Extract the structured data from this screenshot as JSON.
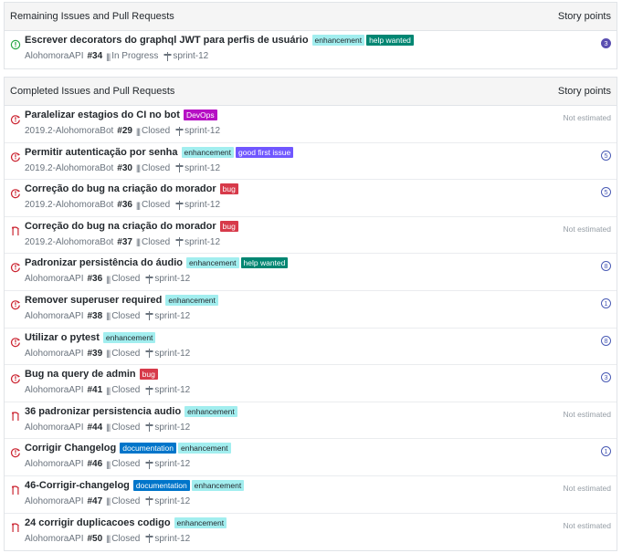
{
  "remaining": {
    "title": "Remaining Issues and Pull Requests",
    "sp_header": "Story points",
    "items": [
      {
        "state": "open",
        "title": "Escrever decorators do graphql JWT para perfis de usuário",
        "labels": [
          {
            "text": "enhancement",
            "bg": "#a2eeef",
            "fg": "#24292e"
          },
          {
            "text": "help wanted",
            "bg": "#008672",
            "fg": "#ffffff"
          }
        ],
        "repo": "AlohomoraAPI",
        "number": "#34",
        "status": "In Progress",
        "milestone": "sprint-12",
        "points": "3",
        "points_style": "filled"
      }
    ]
  },
  "completed": {
    "title": "Completed Issues and Pull Requests",
    "sp_header": "Story points",
    "items": [
      {
        "state": "closed-issue",
        "title": "Paralelizar estagios do CI no bot",
        "labels": [
          {
            "text": "DevOps",
            "bg": "#b60fc4",
            "fg": "#ffffff"
          }
        ],
        "repo": "2019.2-AlohomoraBot",
        "number": "#29",
        "status": "Closed",
        "milestone": "sprint-12",
        "points": "Not estimated",
        "points_style": "text"
      },
      {
        "state": "closed-issue",
        "title": "Permitir autenticação por senha",
        "labels": [
          {
            "text": "enhancement",
            "bg": "#a2eeef",
            "fg": "#24292e"
          },
          {
            "text": "good first issue",
            "bg": "#7057ff",
            "fg": "#ffffff"
          }
        ],
        "repo": "2019.2-AlohomoraBot",
        "number": "#30",
        "status": "Closed",
        "milestone": "sprint-12",
        "points": "5",
        "points_style": "circle"
      },
      {
        "state": "closed-issue",
        "title": "Correção do bug na criação do morador",
        "labels": [
          {
            "text": "bug",
            "bg": "#d73a4a",
            "fg": "#ffffff"
          }
        ],
        "repo": "2019.2-AlohomoraBot",
        "number": "#36",
        "status": "Closed",
        "milestone": "sprint-12",
        "points": "5",
        "points_style": "circle"
      },
      {
        "state": "merged-pr",
        "title": "Correção do bug na criação do morador",
        "labels": [
          {
            "text": "bug",
            "bg": "#d73a4a",
            "fg": "#ffffff"
          }
        ],
        "repo": "2019.2-AlohomoraBot",
        "number": "#37",
        "status": "Closed",
        "milestone": "sprint-12",
        "points": "Not estimated",
        "points_style": "text"
      },
      {
        "state": "closed-issue",
        "title": "Padronizar persistência do áudio",
        "labels": [
          {
            "text": "enhancement",
            "bg": "#a2eeef",
            "fg": "#24292e"
          },
          {
            "text": "help wanted",
            "bg": "#008672",
            "fg": "#ffffff"
          }
        ],
        "repo": "AlohomoraAPI",
        "number": "#36",
        "status": "Closed",
        "milestone": "sprint-12",
        "points": "8",
        "points_style": "circle"
      },
      {
        "state": "closed-issue",
        "title": "Remover superuser required",
        "labels": [
          {
            "text": "enhancement",
            "bg": "#a2eeef",
            "fg": "#24292e"
          }
        ],
        "repo": "AlohomoraAPI",
        "number": "#38",
        "status": "Closed",
        "milestone": "sprint-12",
        "points": "1",
        "points_style": "circle"
      },
      {
        "state": "closed-issue",
        "title": "Utilizar o pytest",
        "labels": [
          {
            "text": "enhancement",
            "bg": "#a2eeef",
            "fg": "#24292e"
          }
        ],
        "repo": "AlohomoraAPI",
        "number": "#39",
        "status": "Closed",
        "milestone": "sprint-12",
        "points": "8",
        "points_style": "circle"
      },
      {
        "state": "closed-issue",
        "title": "Bug na query de admin",
        "labels": [
          {
            "text": "bug",
            "bg": "#d73a4a",
            "fg": "#ffffff"
          }
        ],
        "repo": "AlohomoraAPI",
        "number": "#41",
        "status": "Closed",
        "milestone": "sprint-12",
        "points": "3",
        "points_style": "circle"
      },
      {
        "state": "merged-pr",
        "title": "36 padronizar persistencia audio",
        "labels": [
          {
            "text": "enhancement",
            "bg": "#a2eeef",
            "fg": "#24292e"
          }
        ],
        "repo": "AlohomoraAPI",
        "number": "#44",
        "status": "Closed",
        "milestone": "sprint-12",
        "points": "Not estimated",
        "points_style": "text"
      },
      {
        "state": "closed-issue",
        "title": "Corrigir Changelog",
        "labels": [
          {
            "text": "documentation",
            "bg": "#0075ca",
            "fg": "#ffffff"
          },
          {
            "text": "enhancement",
            "bg": "#a2eeef",
            "fg": "#24292e"
          }
        ],
        "repo": "AlohomoraAPI",
        "number": "#46",
        "status": "Closed",
        "milestone": "sprint-12",
        "points": "1",
        "points_style": "circle"
      },
      {
        "state": "merged-pr",
        "title": "46-Corrigir-changelog",
        "labels": [
          {
            "text": "documentation",
            "bg": "#0075ca",
            "fg": "#ffffff"
          },
          {
            "text": "enhancement",
            "bg": "#a2eeef",
            "fg": "#24292e"
          }
        ],
        "repo": "AlohomoraAPI",
        "number": "#47",
        "status": "Closed",
        "milestone": "sprint-12",
        "points": "Not estimated",
        "points_style": "text"
      },
      {
        "state": "merged-pr",
        "title": "24 corrigir duplicacoes codigo",
        "labels": [
          {
            "text": "enhancement",
            "bg": "#a2eeef",
            "fg": "#24292e"
          }
        ],
        "repo": "AlohomoraAPI",
        "number": "#50",
        "status": "Closed",
        "milestone": "sprint-12",
        "points": "Not estimated",
        "points_style": "text"
      }
    ]
  },
  "icons": {
    "open": "issue-opened-icon",
    "closed-issue": "issue-closed-icon",
    "merged-pr": "pull-request-merged-icon",
    "milestone": "milestone-icon",
    "status": "project-column-icon"
  },
  "colors": {
    "open": "#28a745",
    "closed": "#cb2431",
    "merged": "#cb2431"
  }
}
